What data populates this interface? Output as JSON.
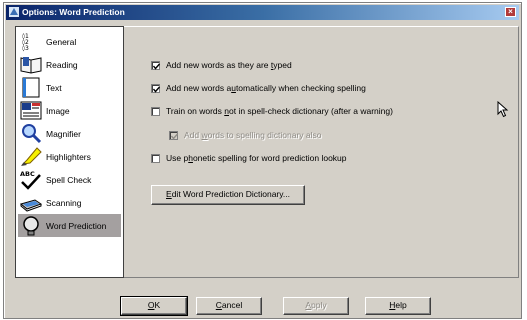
{
  "window": {
    "title": "Options: Word Prediction",
    "close_glyph": "×"
  },
  "sidebar": {
    "items": [
      {
        "label": "General",
        "icon": "general-sliders-icon",
        "underline": "",
        "rest": ""
      },
      {
        "label": "Reading",
        "icon": "reading-book-icon"
      },
      {
        "label": "Text",
        "icon": "text-page-icon"
      },
      {
        "label": "Image",
        "icon": "image-picture-icon"
      },
      {
        "label": "Magnifier",
        "icon": "magnifier-icon"
      },
      {
        "label": "Highlighters",
        "icon": "highlighter-pen-icon"
      },
      {
        "label": "Spell Check",
        "icon": "spell-check-icon"
      },
      {
        "label": "Scanning",
        "icon": "scanner-icon"
      },
      {
        "label": "Word Prediction",
        "icon": "word-prediction-icon",
        "selected": true
      }
    ]
  },
  "options": {
    "add_words_typed": {
      "pre": "Add new words as they are ",
      "u": "t",
      "post": "yped",
      "checked": true
    },
    "add_words_spelling": {
      "pre": "Add new words a",
      "u": "u",
      "post": "tomatically when checking spelling",
      "checked": true
    },
    "train_not_in_dict": {
      "pre": "Train on words ",
      "u": "n",
      "post": "ot in spell-check dictionary (after a warning)",
      "checked": false
    },
    "add_words_spelling_dict": {
      "pre": "Add ",
      "u": "w",
      "post": "ords to spelling dictionary also",
      "checked": true,
      "disabled": true
    },
    "phonetic_spelling": {
      "pre": "Use p",
      "u": "h",
      "post": "onetic spelling for word prediction lookup",
      "checked": false
    }
  },
  "edit_dict_button": {
    "pre": "",
    "u": "E",
    "post": "dit Word Prediction Dictionary..."
  },
  "footer": {
    "ok": {
      "pre": "",
      "u": "O",
      "post": "K"
    },
    "cancel": {
      "pre": "",
      "u": "C",
      "post": "ancel"
    },
    "apply": {
      "pre": "",
      "u": "A",
      "post": "pply"
    },
    "help": {
      "pre": "",
      "u": "H",
      "post": "elp"
    }
  }
}
